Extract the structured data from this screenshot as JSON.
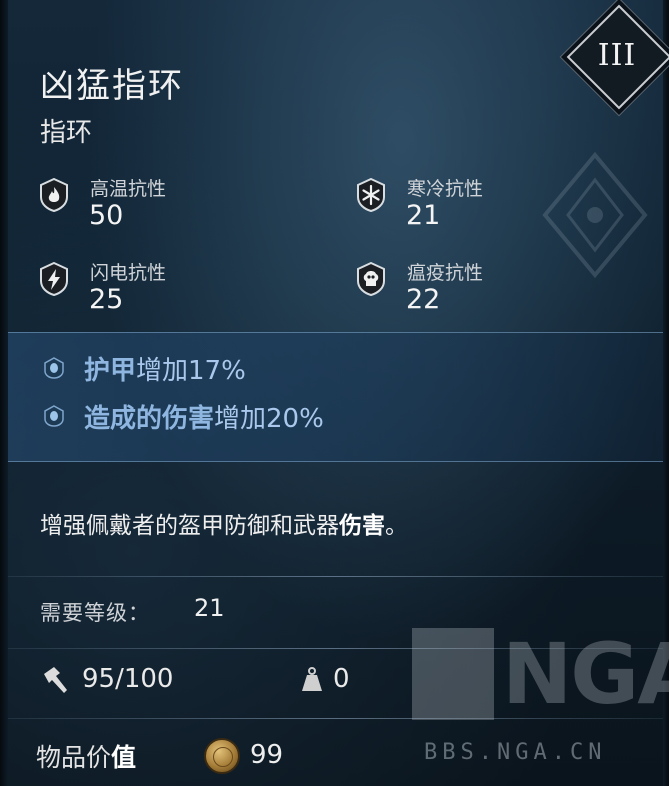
{
  "item": {
    "name": "凶猛指环",
    "type": "指环",
    "tier": "III"
  },
  "resistances": [
    {
      "label": "高温抗性",
      "value": "50",
      "icon": "fire-resistance-icon"
    },
    {
      "label": "寒冷抗性",
      "value": "21",
      "icon": "cold-resistance-icon"
    },
    {
      "label": "闪电抗性",
      "value": "25",
      "icon": "lightning-resistance-icon"
    },
    {
      "label": "瘟疫抗性",
      "value": "22",
      "icon": "plague-resistance-icon"
    }
  ],
  "affixes": [
    {
      "name": "护甲",
      "rest": "增加17%"
    },
    {
      "name": "造成的伤害",
      "rest": "增加20%"
    }
  ],
  "description": {
    "before": "增强佩戴者的盔甲防御和武器",
    "bold": "伤害",
    "after": "。"
  },
  "requirement": {
    "label": "需要等级：",
    "value": "21"
  },
  "durability": {
    "value": "95/100",
    "icon": "hammer-icon"
  },
  "weight": {
    "value": "0",
    "icon": "weight-icon"
  },
  "item_value": {
    "label_a": "物品价",
    "label_b": "值",
    "value": "99",
    "icon": "gold-coin-icon"
  },
  "watermark": {
    "logo_text": "NGA",
    "url": "BBS.NGA.CN"
  },
  "colors": {
    "affix_name": "#8fb6e0",
    "background": "#0f2231"
  }
}
